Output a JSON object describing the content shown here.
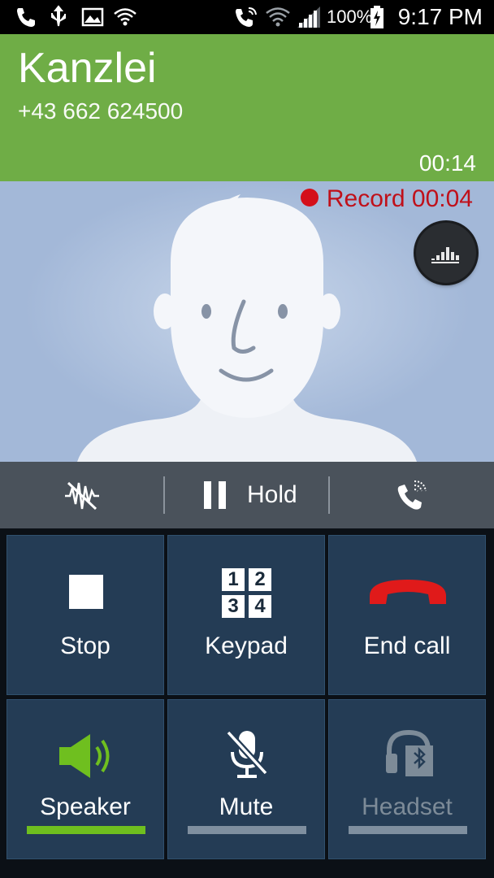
{
  "status_bar": {
    "battery": "100%",
    "time": "9:17 PM"
  },
  "call": {
    "name": "Kanzlei",
    "number": "+43 662 624500",
    "duration": "00:14"
  },
  "record": {
    "label": "Record 00:04"
  },
  "controls": {
    "hold_label": "Hold"
  },
  "actions": {
    "stop": "Stop",
    "keypad": "Keypad",
    "keypad_digits": [
      "1",
      "2",
      "3",
      "4"
    ],
    "end_call": "End call",
    "speaker": "Speaker",
    "mute": "Mute",
    "headset": "Headset"
  },
  "colors": {
    "header_bg": "#6fad46",
    "record_red": "#d40f1a",
    "speaker_active": "#6fbf1f"
  }
}
